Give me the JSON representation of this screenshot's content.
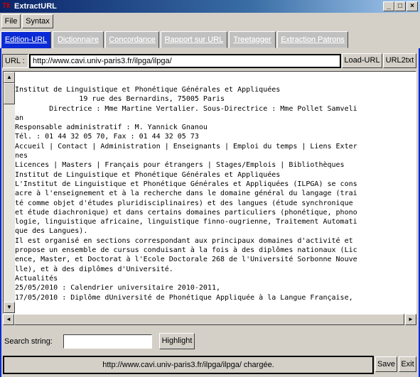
{
  "window": {
    "title": "ExtractURL",
    "app_icon": "Tk"
  },
  "menu": {
    "file": "File",
    "syntax": "Syntax"
  },
  "tabs": [
    {
      "label": "Edition-URL"
    },
    {
      "label": "Dictionnaire"
    },
    {
      "label": "Concordance"
    },
    {
      "label": "Rapport sur URL"
    },
    {
      "label": "Treetagger"
    },
    {
      "label": "Extraction Patrons"
    }
  ],
  "url_bar": {
    "label": "URL :",
    "value": "http://www.cavi.univ-paris3.fr/ilpga/ilpga/",
    "load_button": "Load-URL",
    "url2txt_button": "URL2txt"
  },
  "text_lines": [
    "Institut de Linguistique et Phonétique Générales et Appliquées",
    "               19 rue des Bernardins, 75005 Paris",
    "        Directrice : Mme Martine Vertalier. Sous-Directrice : Mme Pollet Samveli",
    "an",
    "Responsable administratif : M. Yannick Gnanou",
    "Tél. : 01 44 32 05 70, Fax : 01 44 32 05 73",
    "Accueil | Contact | Administration | Enseignants | Emploi du temps | Liens Exter",
    "nes",
    "Licences | Masters | Français pour étrangers | Stages/Emplois | Bibliothèques",
    "Institut de Linguistique et Phonétique Générales et Appliquées",
    "L'Institut de Linguistique et Phonétique Générales et Appliquées (ILPGA) se cons",
    "acre à l'enseignement et à la recherche dans le domaine général du langage (trai",
    "té comme objet d'études pluridisciplinaires) et des langues (étude synchronique",
    "et étude diachronique) et dans certains domaines particuliers (phonétique, phono",
    "logie, linguistique africaine, linguistique finno-ougrienne, Traitement Automati",
    "que des Langues).",
    "Il est organisé en sections correspondant aux principaux domaines d'activité et",
    "propose un ensemble de cursus conduisant à la fois à des diplômes nationaux (Lic",
    "ence, Master, et Doctorat à l'Ecole Doctorale 268 de l'Université Sorbonne Nouve",
    "lle), et à des diplômes d'Université.",
    "Actualités",
    "25/05/2010 : Calendrier universitaire 2010-2011,",
    "17/05/2010 : Diplôme dUniversité de Phonétique Appliquée à la Langue Française,"
  ],
  "search": {
    "label": "Search string:",
    "value": "",
    "highlight_button": "Highlight"
  },
  "status": {
    "message": "http://www.cavi.univ-paris3.fr/ilpga/ilpga/ chargée."
  },
  "bottom_buttons": {
    "save": "Save",
    "exit": "Exit"
  },
  "colors": {
    "accent": "#0a2ad6",
    "arrow": "#1030d0"
  }
}
